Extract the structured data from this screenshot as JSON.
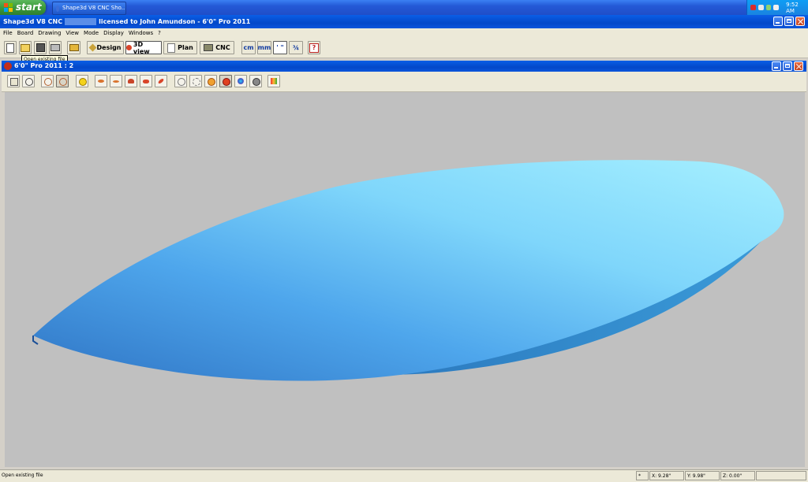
{
  "taskbar": {
    "start_label": "start",
    "task_label": "Shape3d V8 CNC Sho...",
    "clock": "9:52 AM"
  },
  "app_window": {
    "title_prefix": "Shape3d V8 CNC",
    "title_suffix": "licensed to John Amundson - 6'0\" Pro 2011"
  },
  "menu": [
    "File",
    "Board",
    "Drawing",
    "View",
    "Mode",
    "Display",
    "Windows",
    "?"
  ],
  "toolbar": {
    "design_label": "Design",
    "view3d_label": "3D view",
    "plan_label": "Plan",
    "cnc_label": "CNC",
    "unit_cm": "cm",
    "unit_mm": "mm",
    "unit_inch": "' \"",
    "unit_fraction": "¾",
    "tooltip": "Open existing file"
  },
  "document_window": {
    "title": "6'0\" Pro 2011 : 2"
  },
  "statusbar": {
    "message": "Open existing file",
    "marker": "*",
    "x": "X: 9.28\"",
    "y": "Y: 9.98\"",
    "z": "Z: 0.00\""
  },
  "colors": {
    "titlebar": "#0348c9",
    "viewport_bg": "#c0c0c0",
    "board_light": "#8fe6ff",
    "board_dark": "#2f74c4"
  }
}
